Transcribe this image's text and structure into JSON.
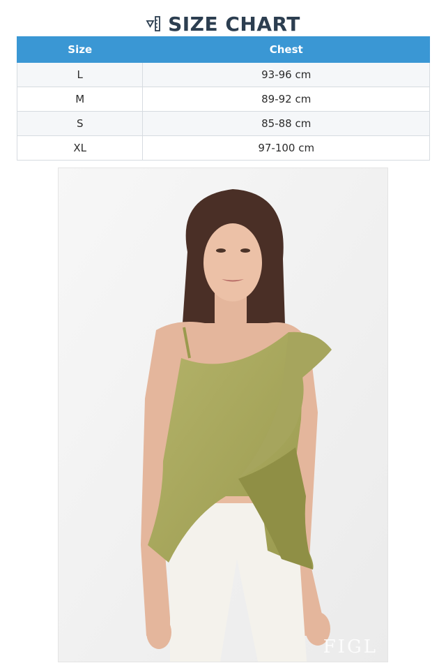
{
  "header": {
    "title": "SIZE CHART",
    "icon": "ruler-icon"
  },
  "size_table": {
    "columns": [
      "Size",
      "Chest"
    ],
    "rows": [
      {
        "size": "L",
        "chest": "93-96 cm"
      },
      {
        "size": "M",
        "chest": "89-92 cm"
      },
      {
        "size": "S",
        "chest": "85-88 cm"
      },
      {
        "size": "XL",
        "chest": "97-100 cm"
      }
    ]
  },
  "product_photo": {
    "watermark": "FIGL"
  },
  "colors": {
    "header_blue": "#3a97d4",
    "title_text": "#2c3e50",
    "garment_olive": "#a9a95c"
  }
}
